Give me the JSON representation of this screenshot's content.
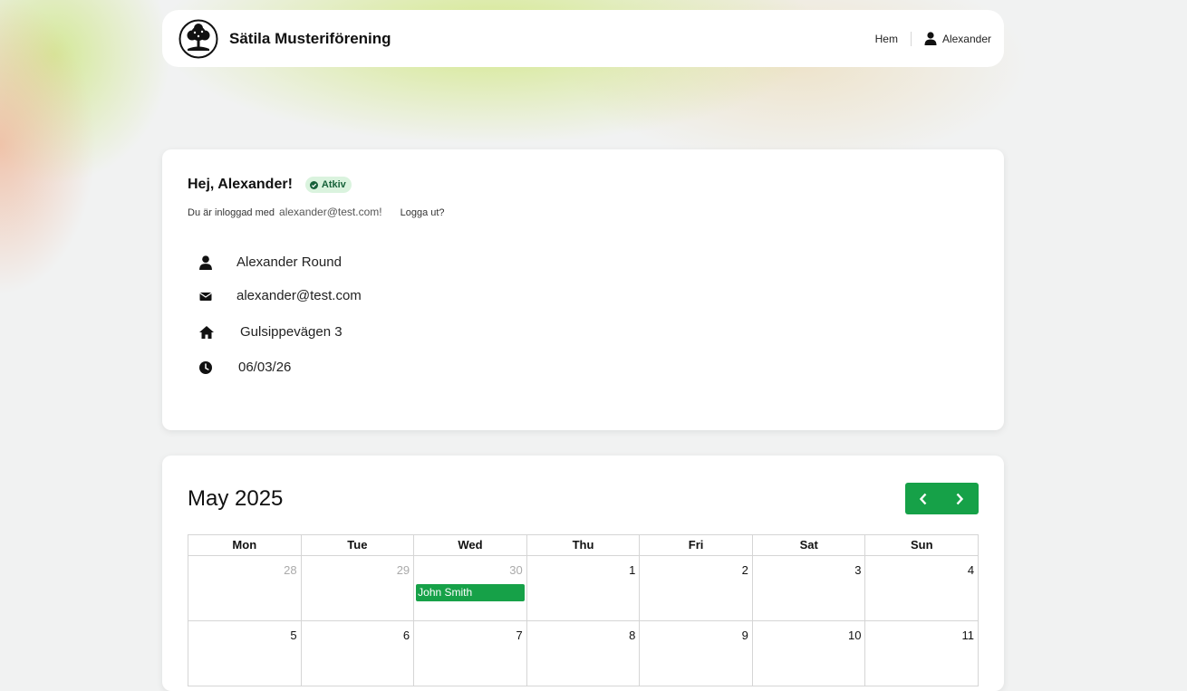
{
  "app": {
    "brand": "Sätila Musteriförening"
  },
  "nav": {
    "home": "Hem",
    "user": "Alexander"
  },
  "profile": {
    "greeting": "Hej, Alexander!",
    "status": "Atkiv",
    "logged_in_prefix": "Du är inloggad med",
    "logged_in_email": "alexander@test.com!",
    "logout": "Logga ut?",
    "name": "Alexander Round",
    "email": "alexander@test.com",
    "address": "Gulsippevägen 3",
    "date": "06/03/26"
  },
  "calendar": {
    "title": "May 2025",
    "weekdays": [
      "Mon",
      "Tue",
      "Wed",
      "Thu",
      "Fri",
      "Sat",
      "Sun"
    ],
    "weeks": [
      [
        {
          "day": "28",
          "other": true
        },
        {
          "day": "29",
          "other": true
        },
        {
          "day": "30",
          "other": true,
          "event": "John Smith"
        },
        {
          "day": "1"
        },
        {
          "day": "2"
        },
        {
          "day": "3"
        },
        {
          "day": "4"
        }
      ],
      [
        {
          "day": "5"
        },
        {
          "day": "6"
        },
        {
          "day": "7"
        },
        {
          "day": "8"
        },
        {
          "day": "9"
        },
        {
          "day": "10"
        },
        {
          "day": "11"
        }
      ]
    ]
  },
  "colors": {
    "accent": "#16a148",
    "badge_bg": "#daf3de",
    "badge_text": "#17623a"
  },
  "icons": {
    "logo": "tree-logo",
    "user": "user-icon",
    "status": "check-circle-icon",
    "email": "envelope-icon",
    "address": "home-icon",
    "date": "clock-icon",
    "prev": "chevron-left-icon",
    "next": "chevron-right-icon"
  }
}
